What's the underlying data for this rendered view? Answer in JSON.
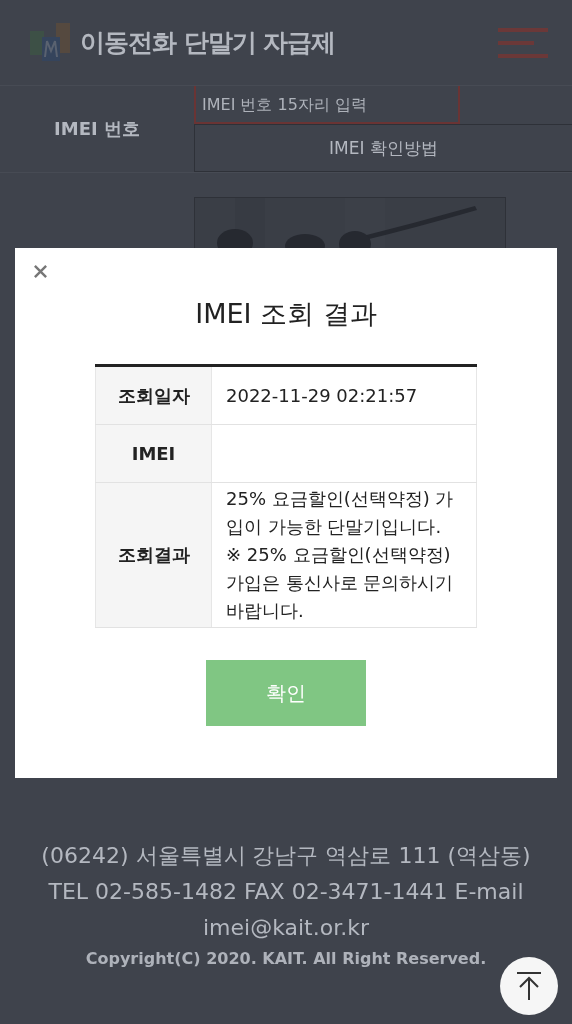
{
  "header": {
    "title": "이동전화 단말기 자급제"
  },
  "form": {
    "label": "IMEI 번호",
    "imei_field": {
      "placeholder": "IMEI 번호 15자리 입력"
    },
    "howto_button": "IMEI 확인방법"
  },
  "dialog": {
    "title": "IMEI 조회 결과",
    "rows": [
      {
        "label": "조회일자",
        "value": [
          "2022-11-29 02:21:57"
        ]
      },
      {
        "label": "IMEI"
      },
      {
        "label": "조회결과",
        "value": [
          "25% 요금할인(선택약정) 가입이 가능한 단말기입니다.",
          "※ 25% 요금할인(선택약정) 가입은 통신사로 문의하시기 바랍니다."
        ]
      }
    ],
    "confirm_button": "확인"
  },
  "footer": {
    "address": "(06242) 서울특별시 강남구 역삼로 111 (역삼동)",
    "contact": "TEL 02-585-1482 FAX 02-3471-1441 E-mail imei@kait.or.kr",
    "copyright": "Copyright(C) 2020. KAIT. All Right Reserved."
  }
}
